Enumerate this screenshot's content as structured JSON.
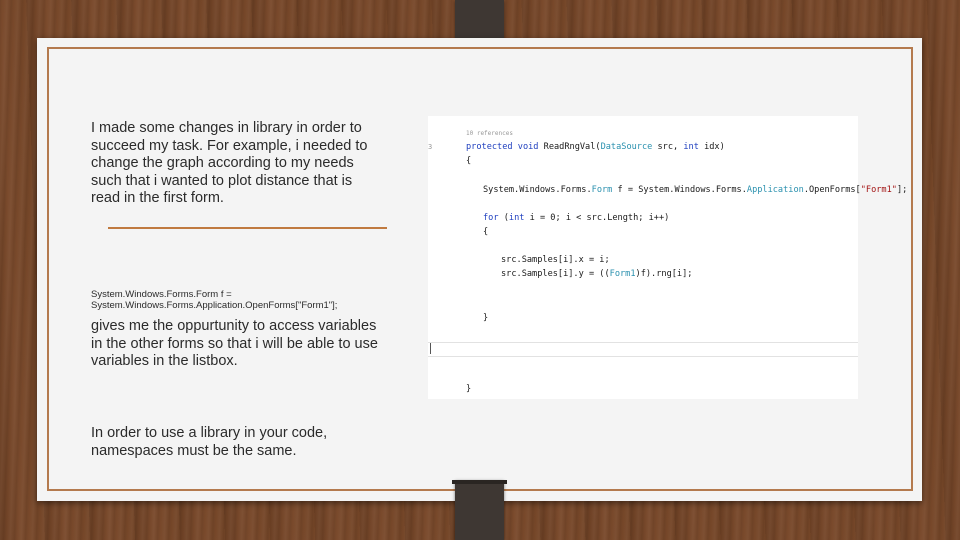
{
  "slide": {
    "paragraph1": "I made some changes in library in order to succeed my task. For example, i needed to change the graph according to my needs such that i wanted to plot distance that is read in the first form.",
    "code_line1": "System.Windows.Forms.Form f =",
    "code_line2": "System.Windows.Forms.Application.OpenForms[\"Form1\"];",
    "paragraph2": "gives me the oppurtunity to access variables in the other forms so that i will be able to use variables in the listbox.",
    "paragraph3": "In order to use a library in your code, namespaces must be the same."
  },
  "code_screenshot": {
    "references": "10 references",
    "signature_kw1": "protected",
    "signature_kw2": "void",
    "signature_name": "ReadRngVal(",
    "signature_type": "DataSource",
    "signature_rest1": " src, ",
    "signature_kw3": "int",
    "signature_rest2": " idx)",
    "open_brace": "{",
    "form_line_a": "System.Windows.Forms.",
    "form_line_type": "Form",
    "form_line_b": " f = System.Windows.Forms.",
    "form_line_app": "Application",
    "form_line_c": ".OpenForms[",
    "form_line_str": "\"Form1\"",
    "form_line_d": "];",
    "for_kw": "for",
    "for_rest1": " (",
    "for_int": "int",
    "for_rest2": " i = 0; i < src.Length; i++)",
    "inner_open": "{",
    "samples_x": "src.Samples[i].x = i;",
    "samples_y_a": "src.Samples[i].y = ((",
    "samples_y_type": "Form1",
    "samples_y_b": ")f).rng[i];",
    "inner_close": "}",
    "close_brace": "}",
    "gutter": "3"
  }
}
